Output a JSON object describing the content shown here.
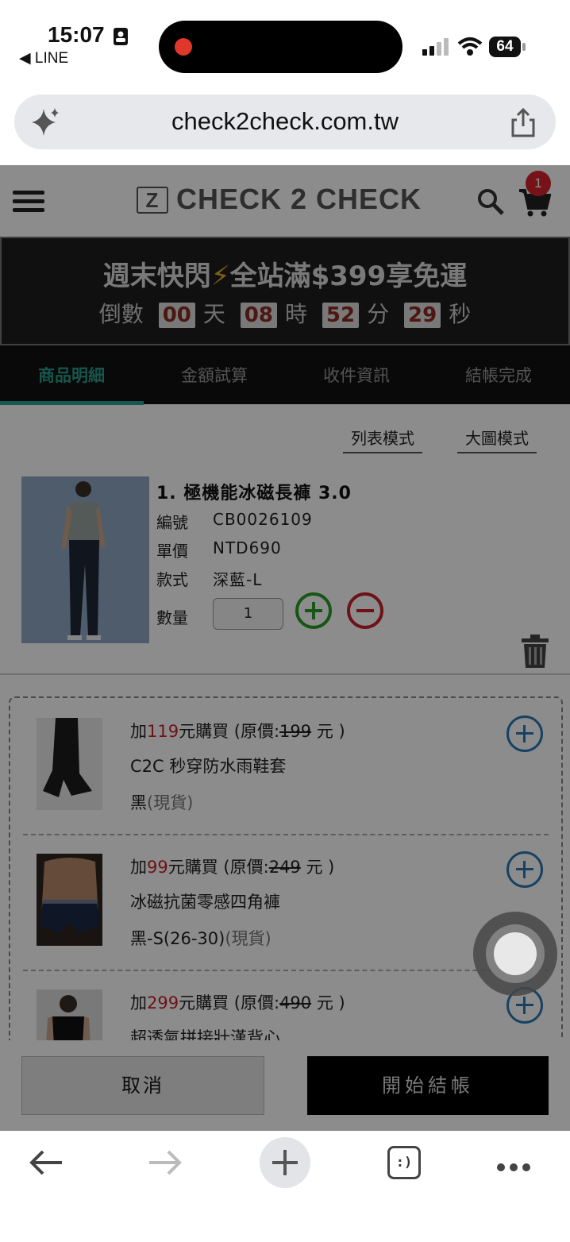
{
  "status_bar": {
    "time": "15:07",
    "back_app": "◀ LINE",
    "battery": "64"
  },
  "browser": {
    "url": "check2check.com.tw"
  },
  "header": {
    "brand": "CHECK 2 CHECK",
    "cart_count": "1"
  },
  "promo": {
    "title_a": "週末快閃",
    "bolt": "⚡",
    "title_b": "全站滿$399享免運",
    "countdown_prefix": "倒數",
    "days": "00",
    "days_label": "天",
    "hours": "08",
    "hours_label": "時",
    "minutes": "52",
    "minutes_label": "分",
    "seconds": "29",
    "seconds_label": "秒"
  },
  "steps": [
    {
      "label": "商品明細",
      "active": true
    },
    {
      "label": "金額試算"
    },
    {
      "label": "收件資訊"
    },
    {
      "label": "結帳完成"
    }
  ],
  "view_modes": {
    "list": "列表模式",
    "large": "大圖模式"
  },
  "product": {
    "title": "1. 極機能冰磁長褲 3.0",
    "code_label": "編號",
    "code": "CB0026109",
    "price_label": "單價",
    "price": "NTD690",
    "style_label": "款式",
    "style": "深藍-L",
    "qty_label": "數量",
    "qty": "1"
  },
  "addons": [
    {
      "prefix": "加",
      "price": "119",
      "mid": "元購買 (原價:",
      "orig": "199",
      "suffix": " 元 )",
      "name": "C2C 秒穿防水雨鞋套",
      "variant": "黑",
      "stock": "(現貨)"
    },
    {
      "prefix": "加",
      "price": "99",
      "mid": "元購買 (原價:",
      "orig": "249",
      "suffix": " 元 )",
      "name": "冰磁抗菌零感四角褲",
      "variant": "黑-S(26-30)",
      "stock": "(現貨)"
    },
    {
      "prefix": "加",
      "price": "299",
      "mid": "元購買 (原價:",
      "orig": "490",
      "suffix": " 元 )",
      "name": "超透氣拼接壯漢背心",
      "variant": "",
      "stock": ""
    }
  ],
  "buttons": {
    "cancel": "取消",
    "checkout": "開始結帳"
  },
  "toolbar": {
    "tabs_glyph": ":)"
  },
  "colors": {
    "accent": "#2aa192",
    "sale_red": "#c8222a",
    "plus_green": "#2a9d2a",
    "add_blue": "#2a78b4"
  }
}
